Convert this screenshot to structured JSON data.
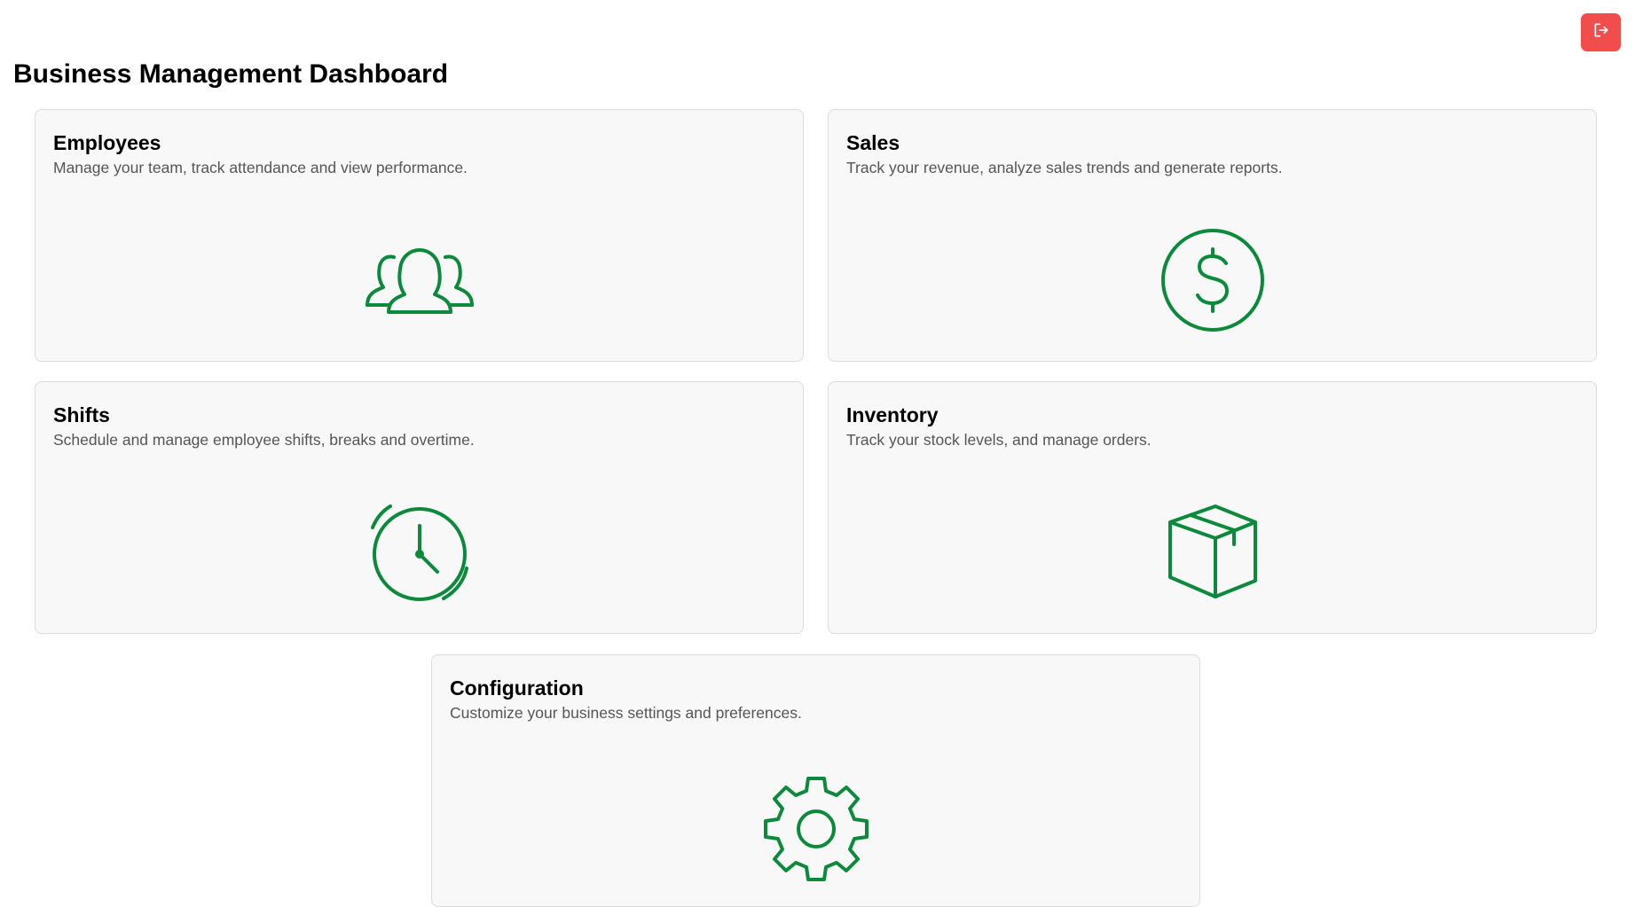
{
  "header": {
    "title": "Business Management Dashboard",
    "logout_icon": "logout-icon",
    "logout_color": "#f24d4d"
  },
  "accent_color": "#0a8a3a",
  "cards": [
    {
      "title": "Employees",
      "description": "Manage your team, track attendance and view performance.",
      "icon": "users-icon"
    },
    {
      "title": "Sales",
      "description": "Track your revenue, analyze sales trends and generate reports.",
      "icon": "dollar-icon"
    },
    {
      "title": "Shifts",
      "description": "Schedule and manage employee shifts, breaks and overtime.",
      "icon": "clock-icon"
    },
    {
      "title": "Inventory",
      "description": "Track your stock levels, and manage orders.",
      "icon": "box-icon"
    },
    {
      "title": "Configuration",
      "description": "Customize your business settings and preferences.",
      "icon": "gear-icon"
    }
  ]
}
